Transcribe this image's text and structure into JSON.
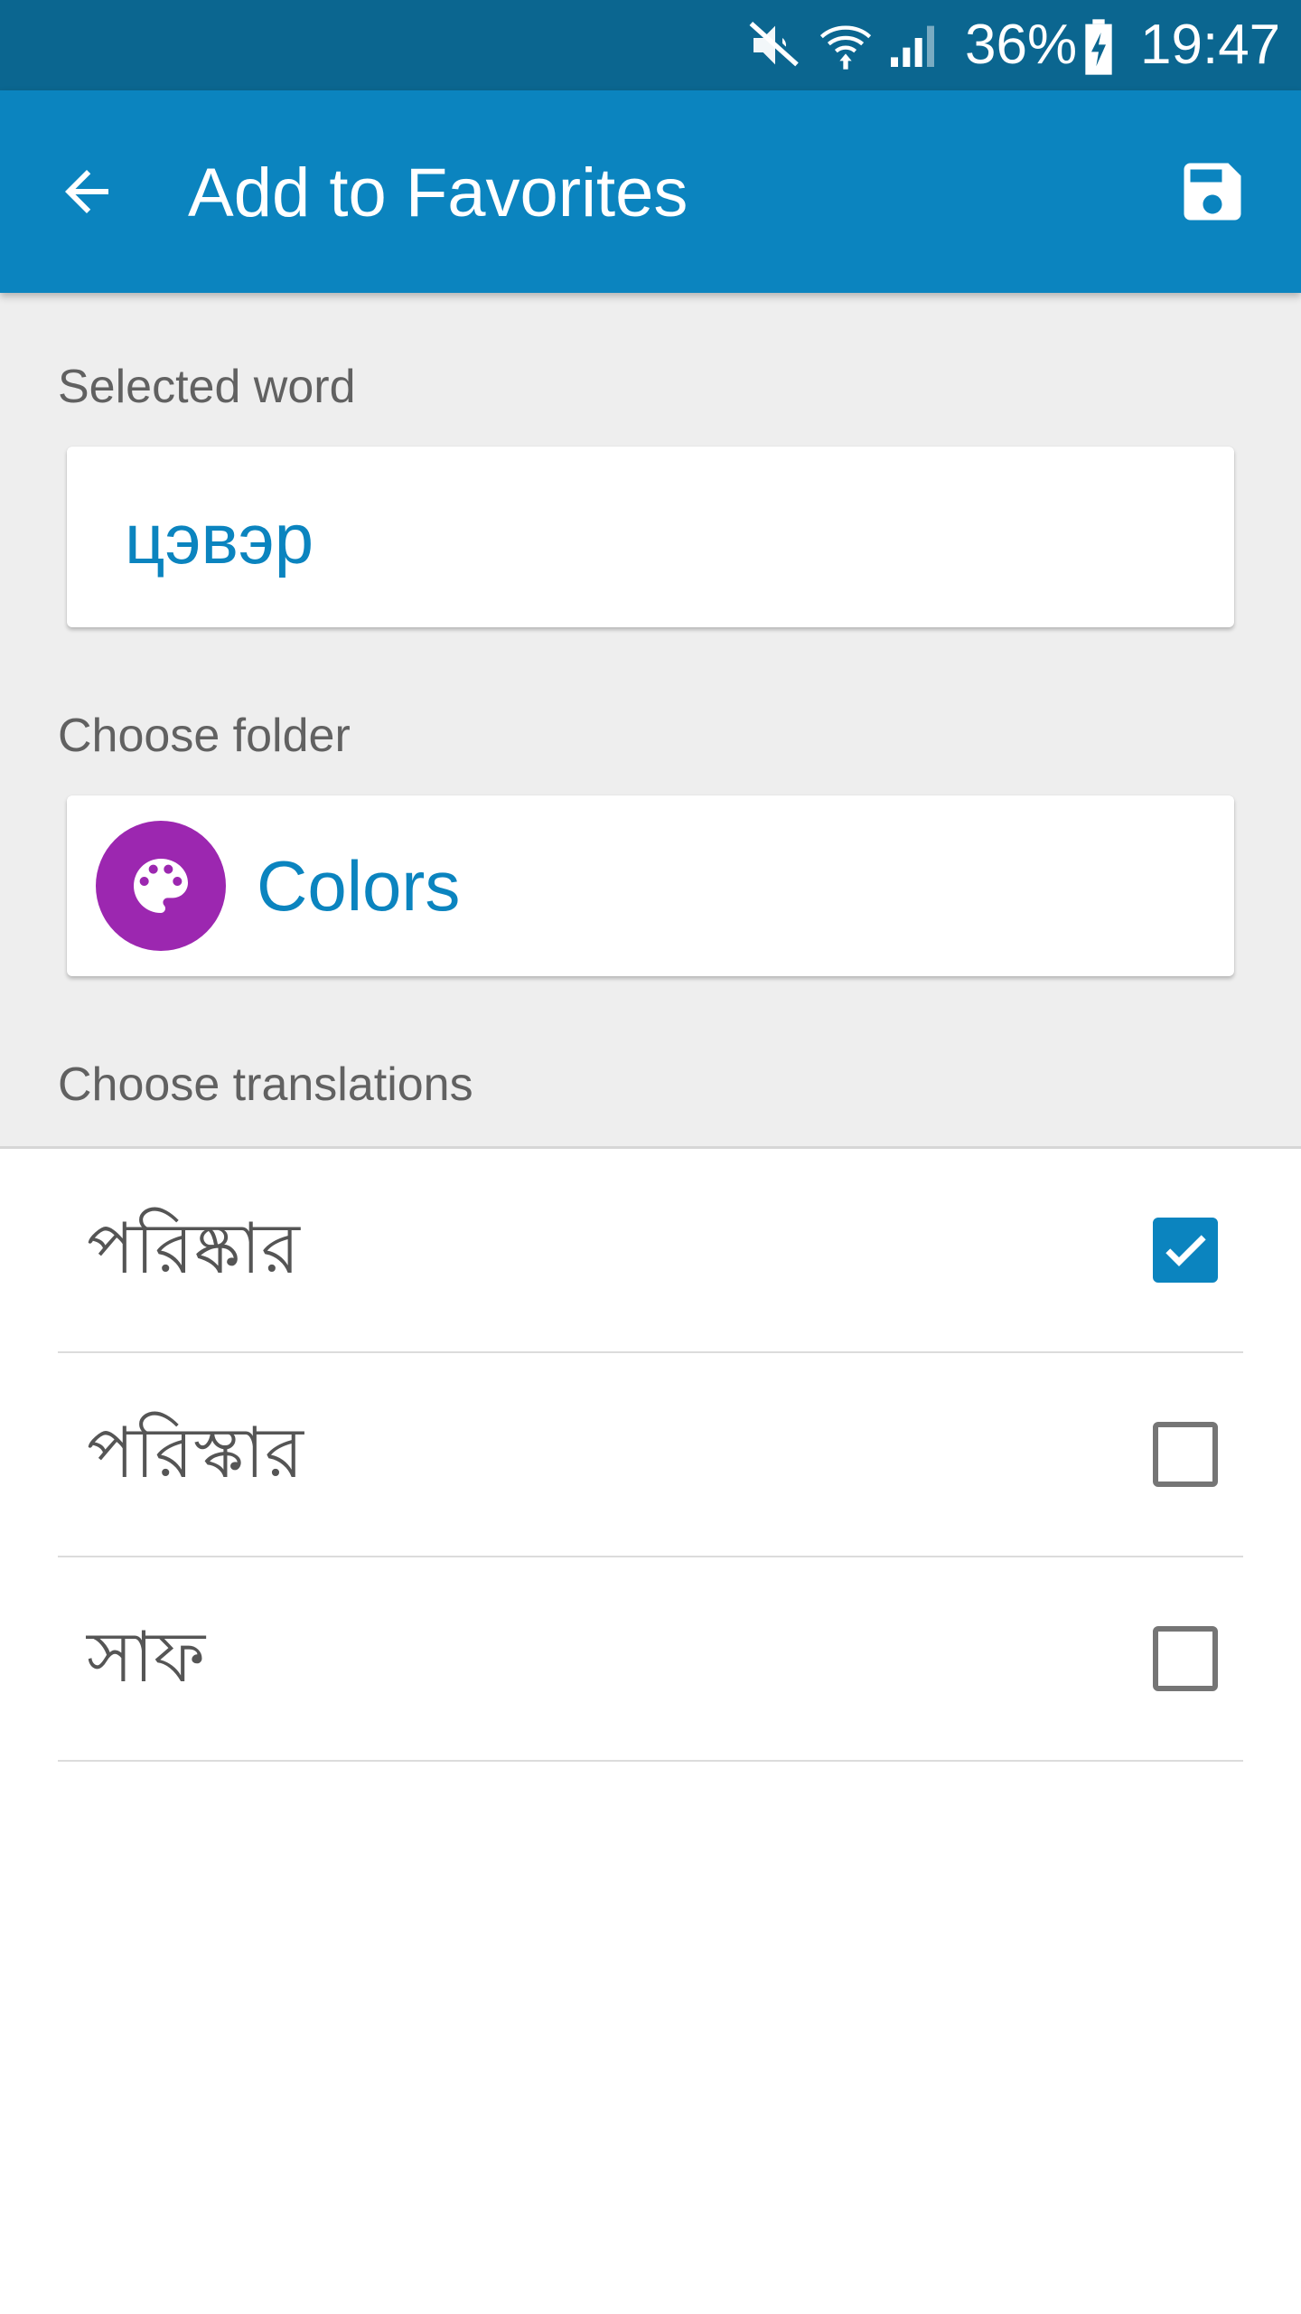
{
  "status_bar": {
    "battery_percent": "36%",
    "time": "19:47",
    "icons": [
      "mute-icon",
      "wifi-icon",
      "signal-icon",
      "battery-charging-icon"
    ]
  },
  "app_bar": {
    "title": "Add to Favorites",
    "back_icon": "arrow-back-icon",
    "save_icon": "save-icon"
  },
  "form": {
    "selected_word_label": "Selected word",
    "selected_word": "цэвэр",
    "choose_folder_label": "Choose folder",
    "folder": {
      "name": "Colors",
      "icon": "palette-icon",
      "icon_color": "#9c27b0"
    },
    "choose_translations_label": "Choose translations"
  },
  "translations": [
    {
      "text": "পরিষ্কার",
      "checked": true
    },
    {
      "text": "পরিস্কার",
      "checked": false
    },
    {
      "text": "সাফ",
      "checked": false
    }
  ],
  "colors": {
    "status_bar": "#0b6690",
    "app_bar": "#0b84bf",
    "accent": "#0b84bf"
  }
}
